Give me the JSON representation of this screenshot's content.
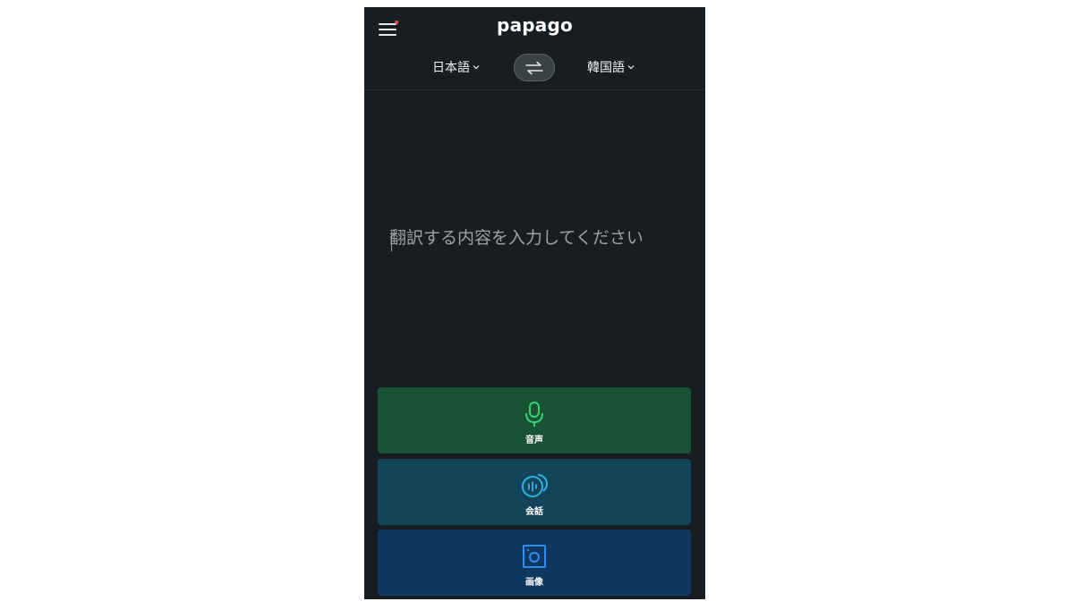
{
  "app": {
    "logo": "papago"
  },
  "header": {
    "source_lang": "日本語",
    "target_lang": "韓国語",
    "notification_dot_color": "#ff4a4a"
  },
  "input": {
    "placeholder": "翻訳する内容を入力してください",
    "value": ""
  },
  "modes": [
    {
      "label": "音声",
      "icon": "microphone-icon",
      "color": "#1a5333",
      "icon_color": "#36d07a"
    },
    {
      "label": "会話",
      "icon": "conversation-icon",
      "color": "#12445a",
      "icon_color": "#2fb1e8"
    },
    {
      "label": "画像",
      "icon": "camera-icon",
      "color": "#0f3860",
      "icon_color": "#2f8cf0"
    }
  ],
  "colors": {
    "background": "#171d20",
    "swap_button": "#3a4246"
  }
}
